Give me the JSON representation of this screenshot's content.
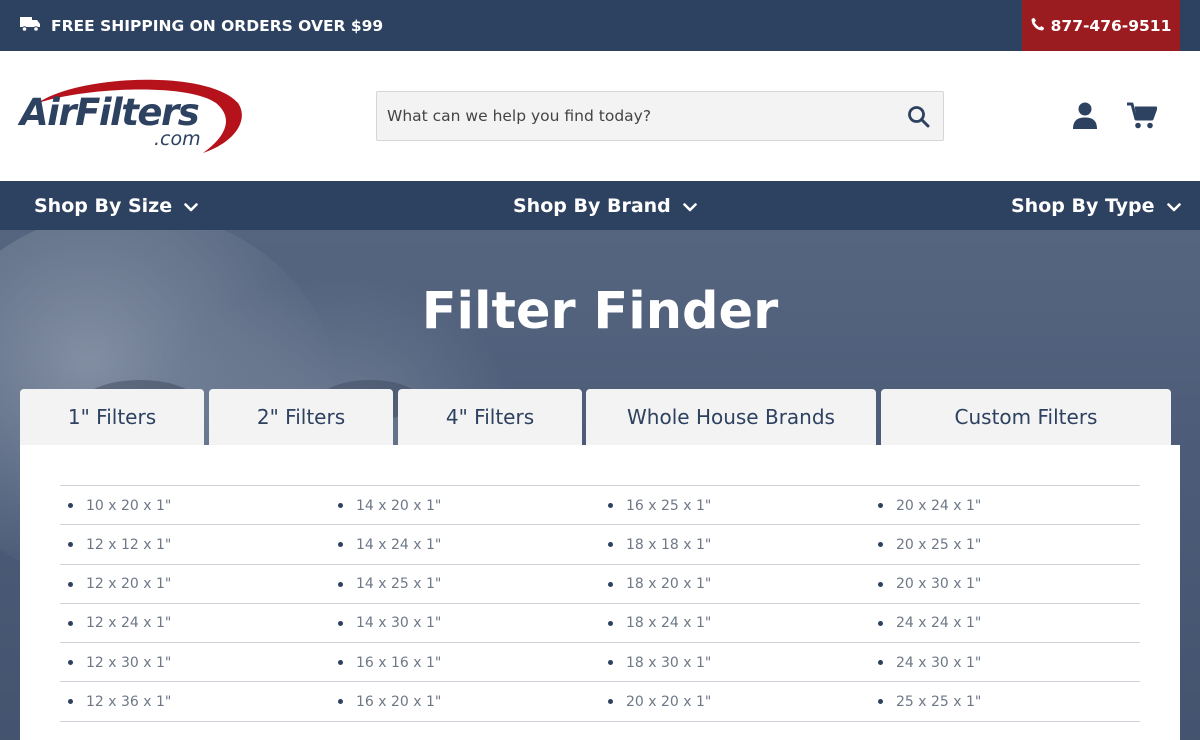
{
  "topbar": {
    "shipping_text": "FREE SHIPPING ON ORDERS OVER $99",
    "shipping_icon": "truck-icon",
    "phone": "877-476-9511",
    "phone_icon": "phone-icon",
    "phone_bg": "#9b1c20"
  },
  "header": {
    "logo_main": "AirFilters",
    "logo_sub": ".com",
    "search_placeholder": "What can we help you find today?",
    "search_value": "",
    "icons": [
      "search-icon",
      "user-icon",
      "cart-icon"
    ]
  },
  "nav": {
    "items": [
      {
        "label": "Shop By Size"
      },
      {
        "label": "Shop By Brand"
      },
      {
        "label": "Shop By Type"
      }
    ]
  },
  "hero": {
    "title": "Filter Finder"
  },
  "tabs": [
    {
      "label": "1\" Filters"
    },
    {
      "label": "2\" Filters"
    },
    {
      "label": "4\" Filters"
    },
    {
      "label": "Whole House Brands"
    },
    {
      "label": "Custom Filters"
    }
  ],
  "sizes": {
    "rows": [
      [
        "10 x 20 x 1\"",
        "14 x 20 x 1\"",
        "16 x 25 x 1\"",
        "20 x 24 x 1\""
      ],
      [
        "12 x 12 x 1\"",
        "14 x 24 x 1\"",
        "18 x 18 x 1\"",
        "20 x 25 x 1\""
      ],
      [
        "12 x 20 x 1\"",
        "14 x 25 x 1\"",
        "18 x 20 x 1\"",
        "20 x 30 x 1\""
      ],
      [
        "12 x 24 x 1\"",
        "14 x 30 x 1\"",
        "18 x 24 x 1\"",
        "24 x 24 x 1\""
      ],
      [
        "12 x 30 x 1\"",
        "16 x 16 x 1\"",
        "18 x 30 x 1\"",
        "24 x 30 x 1\""
      ],
      [
        "12 x 36 x 1\"",
        "16 x 20 x 1\"",
        "20 x 20 x 1\"",
        "25 x 25 x 1\""
      ]
    ]
  },
  "colors": {
    "navy": "#2d4160",
    "accent_red": "#9b1c20",
    "tab_bg": "#f3f3f3"
  }
}
